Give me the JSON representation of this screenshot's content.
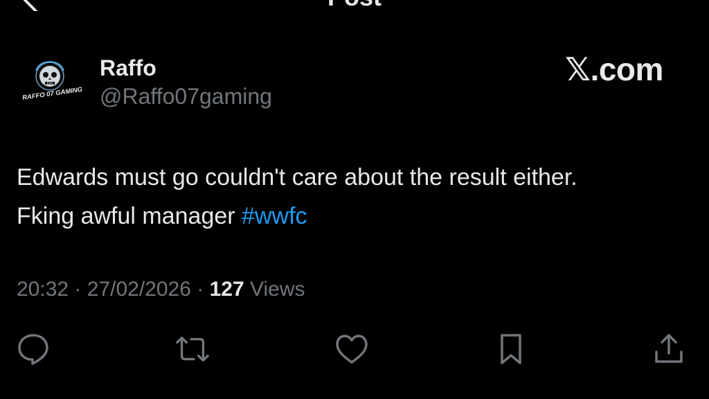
{
  "header": {
    "title": "Post",
    "back_icon": "arrow-left-icon",
    "more_icon": "more-horizontal-icon"
  },
  "post": {
    "author": {
      "name": "Raffo",
      "handle": "@Raffo07gaming",
      "avatar_text": "RAFFO 07 GAMING"
    },
    "brand": {
      "glyph": "𝕏",
      "text": ".com"
    },
    "text_line1": "Edwards must go couldn't care about the result either.",
    "text_line2_plain": "Fking awful manager ",
    "hashtag": "#wwfc",
    "time": "20:32",
    "separator": "·",
    "date": "27/02/2026",
    "views_count": "127",
    "views_label": "Views"
  },
  "actions": [
    {
      "name": "reply",
      "icon": "reply-icon"
    },
    {
      "name": "repost",
      "icon": "repost-icon"
    },
    {
      "name": "like",
      "icon": "heart-icon"
    },
    {
      "name": "bookmark",
      "icon": "bookmark-icon"
    },
    {
      "name": "share",
      "icon": "share-icon"
    }
  ],
  "colors": {
    "background": "#000000",
    "text_primary": "#e7e9ea",
    "text_secondary": "#71767b",
    "link": "#1d9bf0"
  }
}
